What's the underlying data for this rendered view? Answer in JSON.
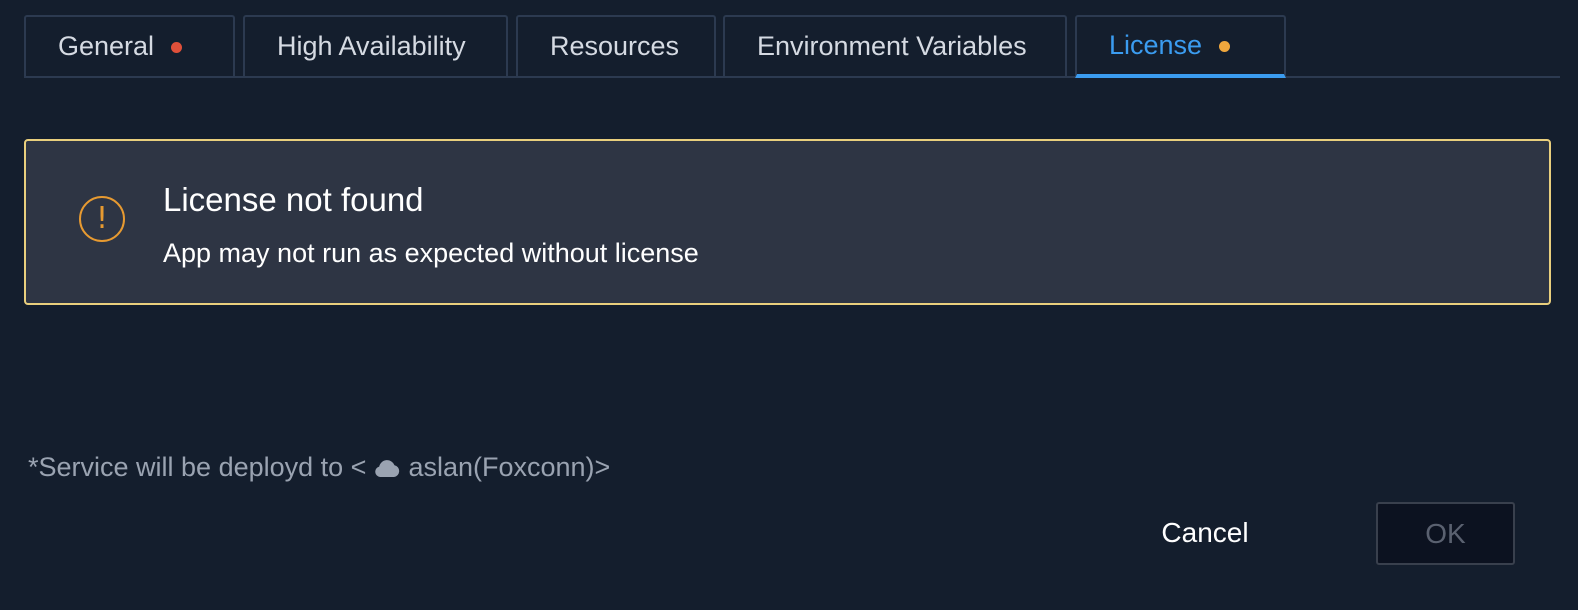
{
  "tabs": [
    {
      "label": "General",
      "badge_color": "#e0503a"
    },
    {
      "label": "High Availability"
    },
    {
      "label": "Resources"
    },
    {
      "label": "Environment Variables"
    },
    {
      "label": "License",
      "badge_color": "#f0a73d",
      "active": true
    }
  ],
  "alert": {
    "icon": "exclamation-circle-icon",
    "icon_glyph": "!",
    "title": "License not found",
    "message": "App may not run as expected without license",
    "border_color": "#e9cf7d",
    "icon_color": "#e79a31"
  },
  "deploy_note": {
    "prefix": "*Service will be deployd to <",
    "icon": "cloud-icon",
    "target": "aslan(Foxconn)>"
  },
  "actions": {
    "cancel_label": "Cancel",
    "ok_label": "OK",
    "ok_disabled": true
  },
  "colors": {
    "background": "#141e2d",
    "accent": "#3b9cf0"
  }
}
